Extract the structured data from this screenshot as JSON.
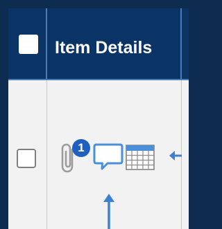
{
  "header": {
    "title": "Item Details"
  },
  "row": {
    "attachment_count": "1"
  },
  "icons": {
    "attachment": "paperclip-icon",
    "comment": "comment-icon",
    "calendar": "calendar-icon"
  },
  "colors": {
    "header_background": "#0b3466",
    "accent": "#4a90d9",
    "badge": "#1f5fbf",
    "row_background": "#f2f2f2"
  }
}
